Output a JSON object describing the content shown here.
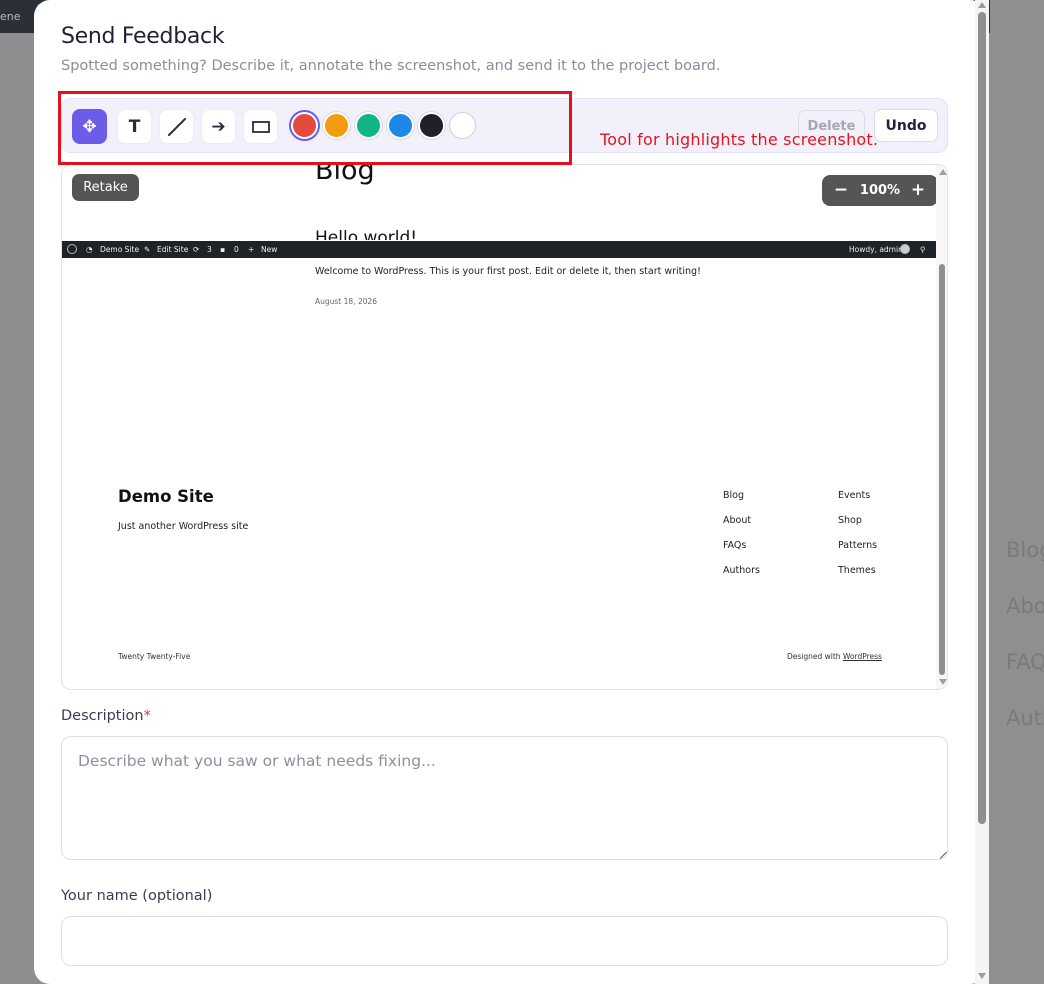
{
  "backdrop": {
    "topbar_text": "ene",
    "nav_items": [
      "Blog",
      "Abo",
      "FAQ",
      "Auth"
    ]
  },
  "modal": {
    "title": "Send Feedback",
    "subtitle": "Spotted something? Describe it, annotate the screenshot, and send it to the project board."
  },
  "toolbar": {
    "tools": [
      {
        "name": "move-tool",
        "glyph": "✥",
        "active": true
      },
      {
        "name": "text-tool",
        "glyph": "T",
        "active": false
      },
      {
        "name": "line-tool",
        "glyph": "╱",
        "active": false
      },
      {
        "name": "arrow-tool",
        "glyph": "➔",
        "active": false
      },
      {
        "name": "rectangle-tool",
        "glyph": "▭",
        "active": false
      }
    ],
    "colors": [
      "#e34b3e",
      "#f39c12",
      "#10b38a",
      "#1e88e5",
      "#1f1f2e",
      "#ffffff"
    ],
    "selected_color": "#e34b3e",
    "delete_label": "Delete",
    "undo_label": "Undo"
  },
  "annotation": {
    "text": "Tool for highlights the screenshot.",
    "color": "#e4101a"
  },
  "screenshot": {
    "retake_label": "Retake",
    "zoom_label": "100%",
    "zoom_minus": "−",
    "zoom_plus": "+",
    "page_heading": "Blog",
    "post_title_fragment": "Hello world!",
    "adminbar": {
      "site": "Demo Site",
      "edit": "Edit Site",
      "updates": "3",
      "comments": "0",
      "new": "New",
      "howdy": "Howdy, admin"
    },
    "welcome_text": "Welcome to WordPress. This is your first post. Edit or delete it, then start writing!",
    "post_date": "August 18, 2026",
    "site_title": "Demo Site",
    "tagline": "Just another WordPress site",
    "nav_col1": [
      "Blog",
      "About",
      "FAQs",
      "Authors"
    ],
    "nav_col2": [
      "Events",
      "Shop",
      "Patterns",
      "Themes"
    ],
    "footer_left": "Twenty Twenty-Five",
    "footer_right_prefix": "Designed with ",
    "footer_right_link": "WordPress"
  },
  "form": {
    "description_label": "Description",
    "description_required": "*",
    "description_placeholder": "Describe what you saw or what needs fixing...",
    "name_label": "Your name (optional)",
    "name_value": ""
  }
}
